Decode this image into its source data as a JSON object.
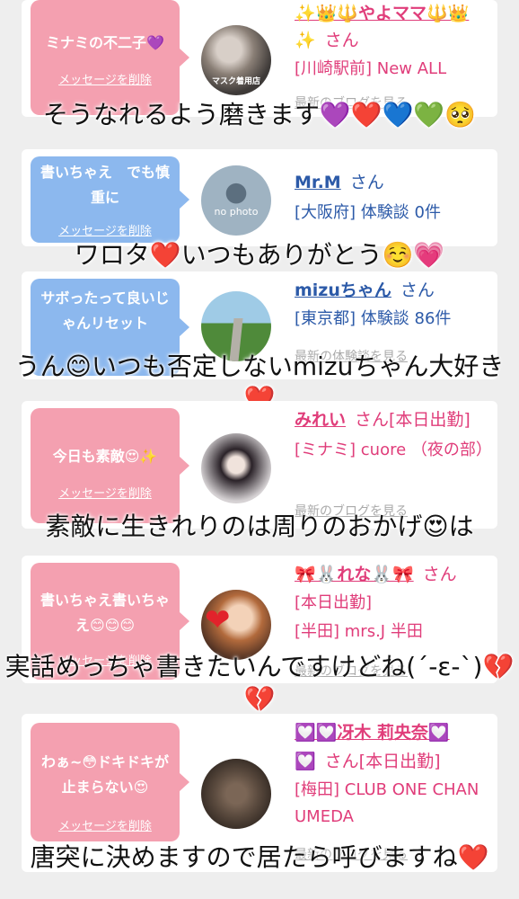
{
  "delete_label": "メッセージを削除",
  "san": "さん",
  "messages": [
    {
      "bubble_text": "ミナミの不二子💜",
      "bubble_color": "pink",
      "name": "✨👑🔱やよママ🔱👑",
      "name_line2": "✨",
      "area": "[川崎駅前] New ALL",
      "latest": "最新のブログを見る",
      "overlay": "そうなれるよう磨きます💜❤️💙💚🥺",
      "avatar_caption": "マスク着用店"
    },
    {
      "bubble_text": "書いちゃえ　でも慎重に",
      "bubble_color": "blue",
      "name": "Mr.M",
      "area": "[大阪府] 体験談 0件",
      "latest": "",
      "overlay": "ワロタ❤️いつもありがとう☺️💗",
      "avatar_caption": "no photo"
    },
    {
      "bubble_text": "サボったって良いじゃんリセット",
      "bubble_color": "blue",
      "name": "mizuちゃん",
      "area": "[東京都] 体験談 86件",
      "latest": "最新の体験談を見る",
      "overlay": "うん😊いつも否定しないmizuちゃん大好き❤️"
    },
    {
      "bubble_text": "今日も素敵😍✨",
      "bubble_color": "pink",
      "name": "みれい",
      "name_suffix": "さん[本日出勤]",
      "area": "[ミナミ] cuore （夜の部）",
      "latest": "最新のブログを見る",
      "overlay": "素敵に生きれりのは周りのおかげ😍は"
    },
    {
      "bubble_text": "書いちゃえ書いちゃえ😊😊😊",
      "bubble_color": "pink",
      "name": "🎀🐰れな🐰🎀",
      "status": "[本日出勤]",
      "area": "[半田] mrs.J 半田",
      "latest": "最新のブログを見る",
      "overlay": "実話めっちゃ書きたいんですけどね(´-ε-`)💔💔"
    },
    {
      "bubble_text": "わぁ~😳ドキドキが止まらない😍",
      "bubble_color": "pink",
      "name": "💟💟冴木 莉央奈💟",
      "name_line2": "💟",
      "name_suffix": "さん[本日出勤]",
      "area": "[梅田] CLUB ONE CHAN UMEDA",
      "latest": "最新のブログを見る",
      "overlay": "唐突に決めますので居たら呼びますね❤️"
    }
  ]
}
